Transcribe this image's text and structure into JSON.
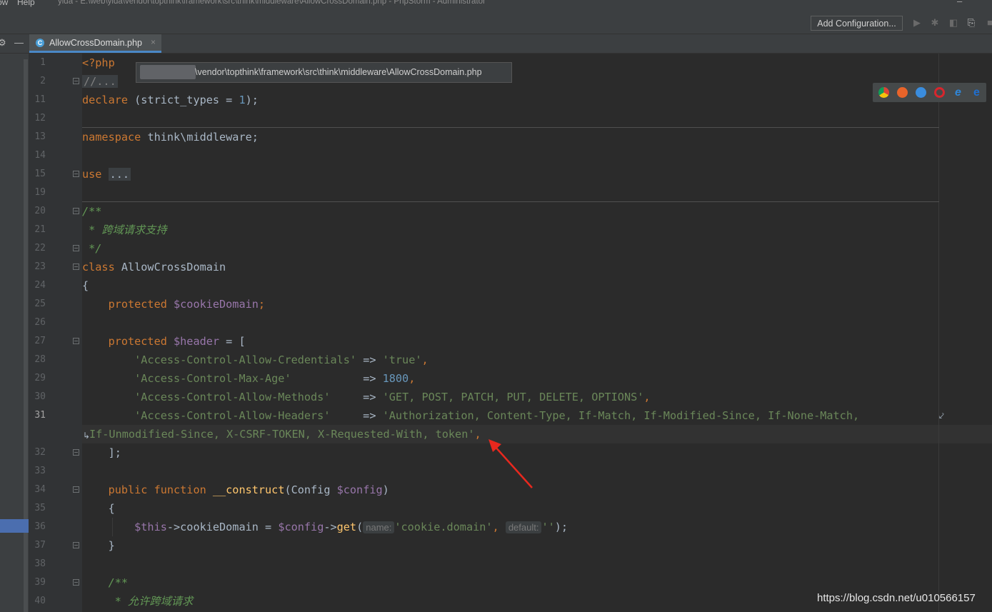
{
  "window": {
    "menu_left": "ow",
    "menu_help": "Help",
    "title": "yida - E:\\web\\yida\\vendor\\topthink\\framework\\src\\think\\middleware\\AllowCrossDomain.php - PhpStorm - Administrator"
  },
  "toolbar": {
    "run_config": "Add Configuration..."
  },
  "tab": {
    "label": "AllowCrossDomain.php",
    "icon_letter": "C"
  },
  "tooltip": {
    "path": "\\vendor\\topthink\\framework\\src\\think\\middleware\\AllowCrossDomain.php"
  },
  "browsers": [
    {
      "name": "chrome-icon",
      "color": "#e6b820"
    },
    {
      "name": "firefox-icon",
      "color": "#e8642a"
    },
    {
      "name": "safari-icon",
      "color": "#3a8dde"
    },
    {
      "name": "opera-icon",
      "color": "#d7262d"
    },
    {
      "name": "ie-icon",
      "color": "#2f86d8"
    },
    {
      "name": "edge-icon",
      "color": "#1f6fd0"
    }
  ],
  "gutter": {
    "line_numbers": [
      "1",
      "2",
      "11",
      "12",
      "13",
      "14",
      "15",
      "19",
      "20",
      "21",
      "22",
      "23",
      "24",
      "25",
      "26",
      "27",
      "28",
      "29",
      "30",
      "31",
      "",
      "32",
      "33",
      "34",
      "35",
      "36",
      "37",
      "38",
      "39",
      "40"
    ],
    "active_line": "31"
  },
  "code": {
    "l1": "<?php",
    "l2": "//...",
    "l11_kw": "declare",
    "l11_a": " (strict_types = ",
    "l11_num": "1",
    "l11_b": ");",
    "l13_kw": "namespace",
    "l13_rest": " think\\middleware;",
    "l15_kw": "use",
    "l15_fold": "...",
    "l20": "/**",
    "l21": " * 跨域请求支持",
    "l22": " */",
    "l23_kw": "class",
    "l23_name": " AllowCrossDomain",
    "l24": "{",
    "l25_kw": "    protected",
    "l25_var": " $cookieDomain",
    "l25_end": ";",
    "l27_kw": "    protected",
    "l27_var": " $header",
    "l27_end": " = [",
    "l28_key": "        'Access-Control-Allow-Credentials'",
    "l28_arrow": " => ",
    "l28_val": "'true'",
    "l28_end": ",",
    "l29_key": "        'Access-Control-Max-Age'",
    "l29_arrow": "           => ",
    "l29_val": "1800",
    "l29_end": ",",
    "l30_key": "        'Access-Control-Allow-Methods'",
    "l30_arrow": "     => ",
    "l30_val": "'GET, POST, PATCH, PUT, DELETE, OPTIONS'",
    "l30_end": ",",
    "l31_key": "        'Access-Control-Allow-Headers'",
    "l31_arrow": "     => ",
    "l31_val": "'Authorization, Content-Type, If-Match, If-Modified-Since, If-None-Match,",
    "l31w_val": "If-Unmodified-Since, X-CSRF-TOKEN, X-Requested-With, token'",
    "l31w_end": ",",
    "l32": "    ];",
    "l34_kw": "    public function",
    "l34_fn": " __construct",
    "l34_a": "(Config ",
    "l34_var": "$config",
    "l34_b": ")",
    "l35": "    {",
    "l36_var1": "        $this",
    "l36_a": "->cookieDomain = ",
    "l36_var2": "$config",
    "l36_b": "->",
    "l36_fn": "get",
    "l36_c": "(",
    "l36_hint1": "name:",
    "l36_str1": "'cookie.domain'",
    "l36_d": ", ",
    "l36_hint2": "default:",
    "l36_str2": "''",
    "l36_e": ");",
    "l37": "    }",
    "l39": "    /**",
    "l40": "     * 允许跨域请求"
  },
  "watermark": "https://blog.csdn.net/u010566157"
}
